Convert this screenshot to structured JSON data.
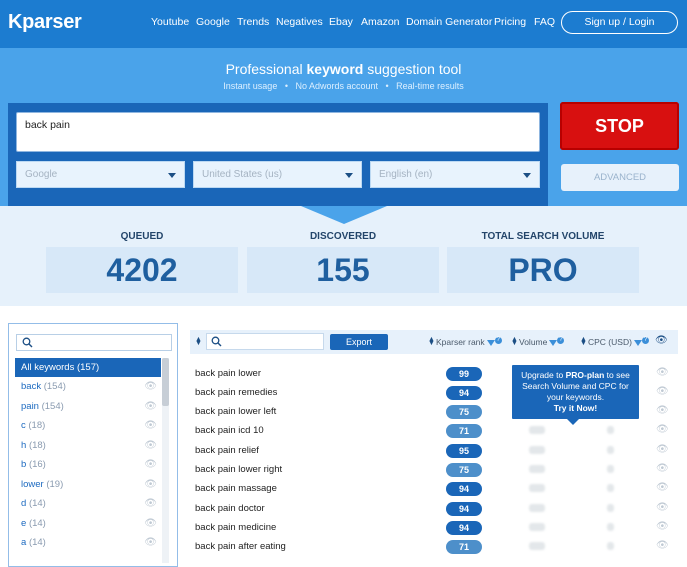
{
  "header": {
    "logo": "Kparser",
    "nav": [
      "Youtube",
      "Google",
      "Trends",
      "Negatives",
      "Ebay",
      "Amazon",
      "Domain Generator",
      "Pricing",
      "FAQ"
    ],
    "signup": "Sign up / Login"
  },
  "hero": {
    "title_pre": "Professional ",
    "title_bold": "keyword",
    "title_post": " suggestion tool",
    "sub": "Instant usage   •   No Adwords account   •   Real-time results"
  },
  "search": {
    "query": "back pain",
    "source": "Google",
    "country": "United States (us)",
    "language": "English (en)",
    "stop_label": "STOP",
    "advanced_label": "ADVANCED"
  },
  "stats": {
    "queued_label": "QUEUED",
    "queued_value": "4202",
    "discovered_label": "DISCOVERED",
    "discovered_value": "155",
    "volume_label": "TOTAL SEARCH VOLUME",
    "volume_value": "PRO"
  },
  "filters": {
    "items": [
      {
        "label": "All keywords",
        "count": "(157)"
      },
      {
        "label": "back",
        "count": "(154)"
      },
      {
        "label": "pain",
        "count": "(154)"
      },
      {
        "label": "c",
        "count": "(18)"
      },
      {
        "label": "h",
        "count": "(18)"
      },
      {
        "label": "b",
        "count": "(16)"
      },
      {
        "label": "lower",
        "count": "(19)"
      },
      {
        "label": "d",
        "count": "(14)"
      },
      {
        "label": "e",
        "count": "(14)"
      },
      {
        "label": "a",
        "count": "(14)"
      }
    ]
  },
  "results": {
    "export_label": "Export",
    "col_rank": "Kparser rank",
    "col_volume": "Volume",
    "col_cpc": "CPC (USD)",
    "upgrade_line1": "Upgrade to ",
    "upgrade_bold": "PRO-plan",
    "upgrade_line1_post": " to see",
    "upgrade_line2": "Search Volume and CPC for",
    "upgrade_line3": "your keywords.",
    "upgrade_cta": "Try it Now!",
    "rows": [
      {
        "kw": "back pain lower",
        "rank": "99"
      },
      {
        "kw": "back pain remedies",
        "rank": "94"
      },
      {
        "kw": "back pain lower left",
        "rank": "75"
      },
      {
        "kw": "back pain icd 10",
        "rank": "71"
      },
      {
        "kw": "back pain relief",
        "rank": "95"
      },
      {
        "kw": "back pain lower right",
        "rank": "75"
      },
      {
        "kw": "back pain massage",
        "rank": "94"
      },
      {
        "kw": "back pain doctor",
        "rank": "94"
      },
      {
        "kw": "back pain medicine",
        "rank": "94"
      },
      {
        "kw": "back pain after eating",
        "rank": "71"
      }
    ]
  }
}
